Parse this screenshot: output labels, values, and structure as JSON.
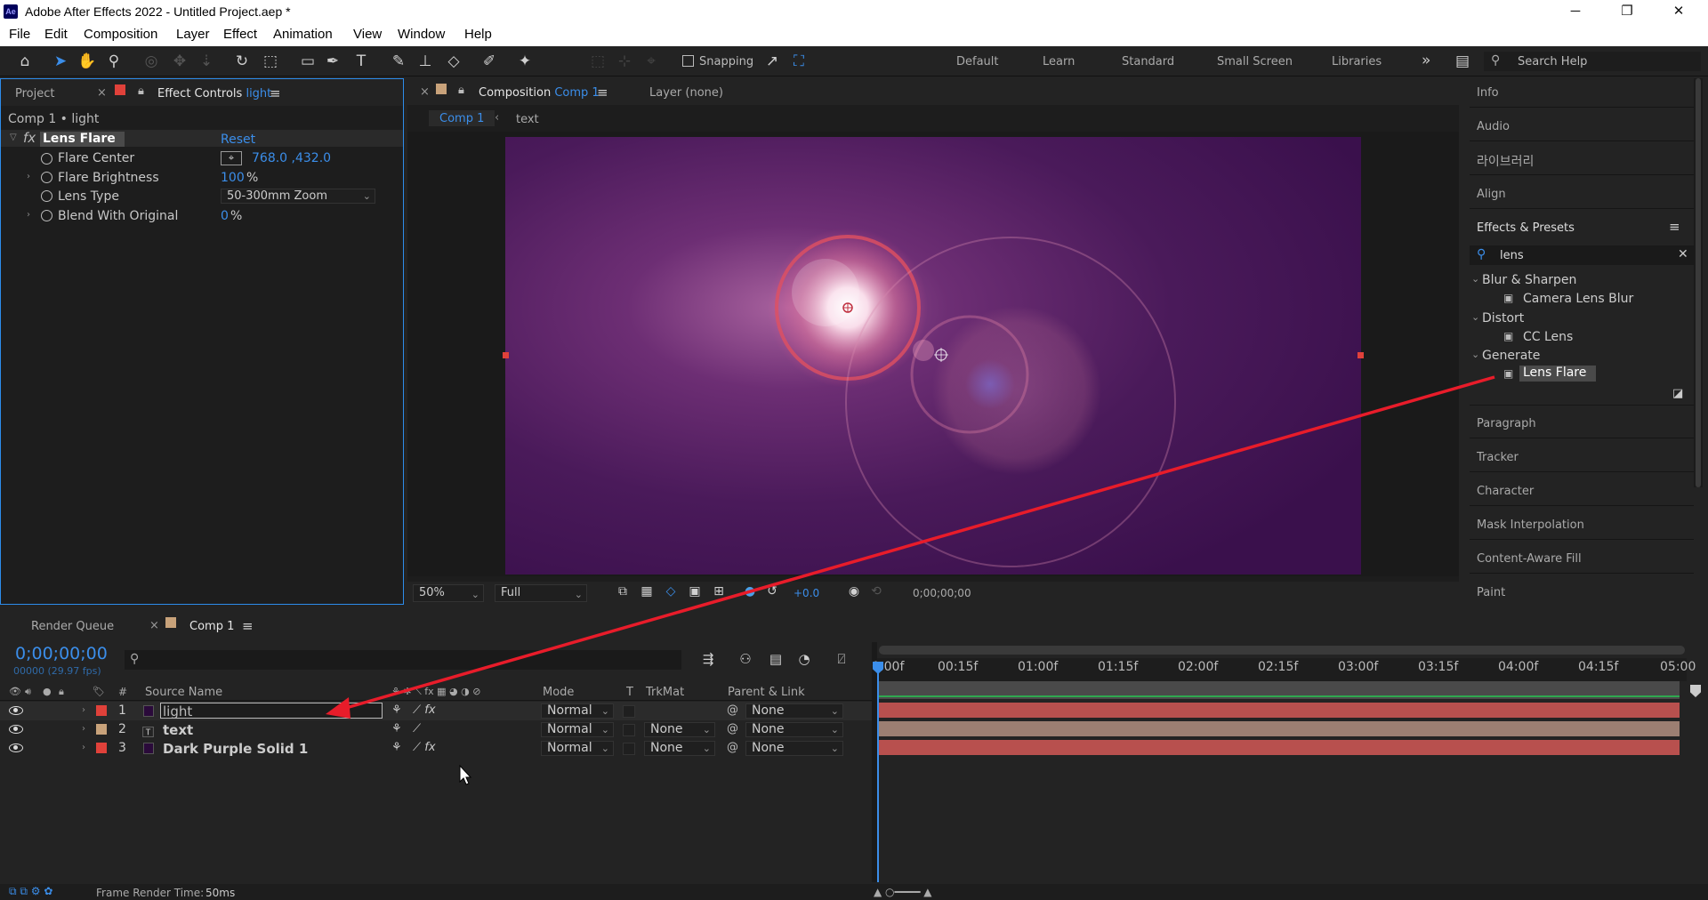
{
  "window": {
    "title": "Adobe After Effects 2022 - Untitled Project.aep *",
    "logo": "Ae",
    "minimize": "─",
    "maximize": "❐",
    "close": "✕"
  },
  "menu": [
    "File",
    "Edit",
    "Composition",
    "Layer",
    "Effect",
    "Animation",
    "View",
    "Window",
    "Help"
  ],
  "toolbar": {
    "snapping": "Snapping",
    "workspaces": [
      "Default",
      "Learn",
      "Standard",
      "Small Screen",
      "Libraries"
    ],
    "more": "»",
    "search_placeholder": "Search Help"
  },
  "project_panel": {
    "tab_project": "Project",
    "tab_effect_controls": "Effect Controls",
    "effect_layer": "light",
    "breadcrumb": "Comp 1 • light",
    "effect_name": "Lens Flare",
    "reset": "Reset",
    "fx": "fx",
    "props": [
      {
        "name": "Flare Center",
        "value": "768.0 ,432.0"
      },
      {
        "name": "Flare Brightness",
        "value": "100",
        "unit": "%"
      },
      {
        "name": "Lens Type",
        "value": "50-300mm Zoom"
      },
      {
        "name": "Blend With Original",
        "value": "0",
        "unit": "%"
      }
    ]
  },
  "comp_panel": {
    "tab_label": "Composition",
    "comp_name": "Comp 1",
    "layer_tab": "Layer (none)",
    "crumbs": [
      "Comp 1",
      "text"
    ],
    "zoom": "50%",
    "resolution": "Full",
    "exposure": "+0.0",
    "timecode": "0;00;00;00"
  },
  "right_panel": {
    "info": "Info",
    "audio": "Audio",
    "libraries": "라이브러리",
    "align": "Align",
    "effects_presets": "Effects & Presets",
    "search_value": "lens",
    "groups": [
      {
        "name": "Blur & Sharpen",
        "item": "Camera Lens Blur"
      },
      {
        "name": "Distort",
        "item": "CC Lens"
      },
      {
        "name": "Generate",
        "item": "Lens Flare"
      }
    ],
    "panels": [
      "Paragraph",
      "Tracker",
      "Character",
      "Mask Interpolation",
      "Content-Aware Fill",
      "Paint"
    ]
  },
  "timeline": {
    "tab_render": "Render Queue",
    "tab_comp": "Comp 1",
    "timecode": "0;00;00;00",
    "fps": "00000 (29.97 fps)",
    "headers": {
      "num": "#",
      "source": "Source Name",
      "mode": "Mode",
      "t": "T",
      "trkmat": "TrkMat",
      "parent": "Parent & Link"
    },
    "layers": [
      {
        "num": "1",
        "name": "light",
        "mode": "Normal",
        "trkmat": "",
        "parent": "None",
        "color": "#e0413a",
        "thumb": "#2a0a3a"
      },
      {
        "num": "2",
        "name": "text",
        "mode": "Normal",
        "trkmat": "None",
        "parent": "None",
        "color": "#c8a27a",
        "thumb": "#444"
      },
      {
        "num": "3",
        "name": "Dark Purple Solid 1",
        "mode": "Normal",
        "trkmat": "None",
        "parent": "None",
        "color": "#e0413a",
        "thumb": "#2a0a3a"
      }
    ],
    "ruler": [
      "0:00f",
      "00:15f",
      "01:00f",
      "01:15f",
      "02:00f",
      "02:15f",
      "03:00f",
      "03:15f",
      "04:00f",
      "04:15f",
      "05:00"
    ],
    "status": "Frame Render Time:",
    "render_time": "50ms"
  },
  "colors": {
    "accent": "#3b8eea",
    "layer_bar_red": "#b8504e",
    "layer_bar_tan": "#9c7f72",
    "annotation": "#e81c2a"
  }
}
